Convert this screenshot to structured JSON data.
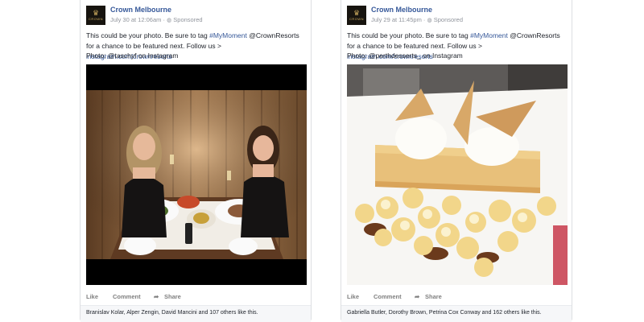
{
  "posts": [
    {
      "page_name": "Crown Melbourne",
      "date": "July 30 at 12:06am",
      "sponsored": "Sponsored",
      "text_1": "This could be your photo. Be sure to tag ",
      "hashtag": "#MyMoment",
      "text_2": " @CrownResorts for a chance to be featured next. Follow us > ",
      "link": "instagram.com/crownresorts",
      "photo_credit": "Photo: @taschyf on Instagram",
      "actions": {
        "like": "Like",
        "comment": "Comment",
        "share": "Share"
      },
      "likes": "Branislav Kolar, Alper Zengin, David Mancini and 107 others like this."
    },
    {
      "page_name": "Crown Melbourne",
      "date": "July 29 at 11:45pm",
      "sponsored": "Sponsored",
      "text_1": "This could be your photo. Be sure to tag ",
      "hashtag": "#MyMoment",
      "text_2": " @CrownResorts for a chance to be featured next. Follow us > ",
      "link": "instagram.com/crownresorts",
      "photo_credit": "Photo: @perthdesserts_ on Instagram",
      "actions": {
        "like": "Like",
        "comment": "Comment",
        "share": "Share"
      },
      "likes": "Gabriella Butler, Dorothy Brown, Petrina Cox Conway and 162 others like this."
    }
  ],
  "logo": {
    "icon": "crown-icon",
    "wordmark": "CROWN"
  },
  "colors": {
    "link": "#365899",
    "meta": "#90949c",
    "border": "#dddfe2"
  }
}
